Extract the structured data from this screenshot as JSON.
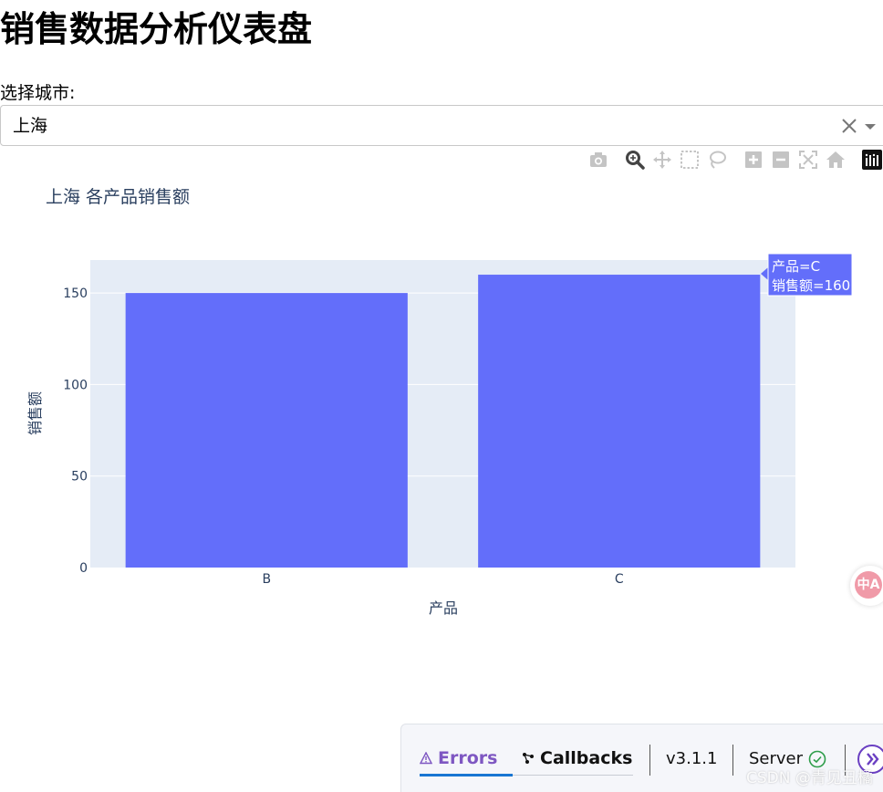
{
  "page": {
    "title": "销售数据分析仪表盘"
  },
  "filter": {
    "label": "选择城市:",
    "selected_value": "上海"
  },
  "modebar": {
    "icons": [
      "camera-icon",
      "zoom-icon",
      "pan-icon",
      "box-select-icon",
      "lasso-icon",
      "zoom-in-icon",
      "zoom-out-icon",
      "autoscale-icon",
      "reset-axes-icon",
      "plotly-logo-icon"
    ],
    "active_color": "#444444",
    "inactive_color": "#c4c4c4"
  },
  "chart_data": {
    "type": "bar",
    "title": "上海 各产品销售额",
    "xlabel": "产品",
    "ylabel": "销售额",
    "categories": [
      "B",
      "C"
    ],
    "values": [
      150,
      160
    ],
    "yticks": [
      0,
      50,
      100,
      150
    ],
    "ylim": [
      0,
      168
    ],
    "grid": true,
    "bar_color": "#636efa",
    "plot_bg": "#e5ecf6",
    "hover": {
      "line1": "产品=C",
      "line2": "销售额=160"
    }
  },
  "devtools": {
    "errors_label": "Errors",
    "callbacks_label": "Callbacks",
    "version": "v3.1.1",
    "server_label": "Server",
    "accent_color": "#7e57c2"
  },
  "watermark": "CSDN @青见丑橘",
  "translate_label": "中A"
}
